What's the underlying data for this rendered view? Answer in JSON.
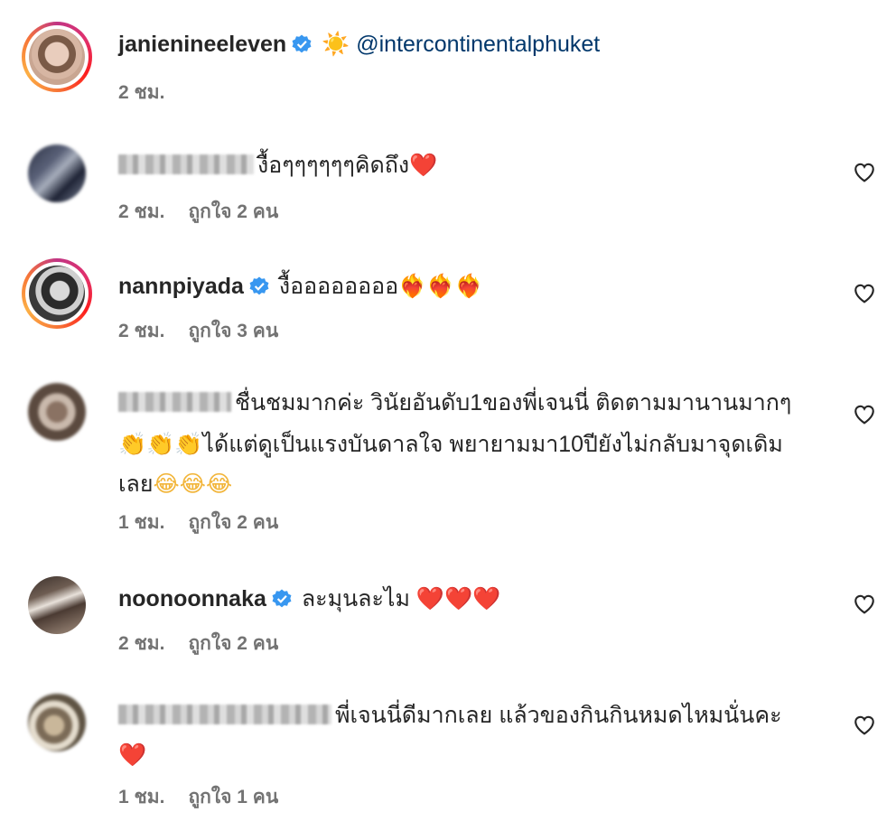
{
  "post": {
    "username": "janienineeleven",
    "sun_emoji": "☀️",
    "mention": "@intercontinentalphuket",
    "time": "2 ชม."
  },
  "comments": [
    {
      "username": "",
      "text": "งื้อๆๆๆๆๆๆคิดถึง",
      "emoji": "❤️",
      "time": "2 ชม.",
      "likes": "ถูกใจ 2 คน"
    },
    {
      "username": "nannpiyada",
      "text": "งื้ออออออออ",
      "emoji": "❤️‍🔥❤️‍🔥❤️‍🔥",
      "time": "2 ชม.",
      "likes": "ถูกใจ 3 คน"
    },
    {
      "username": "",
      "text_line1": "ชื่นชมมากค่ะ วินัยอันดับ1ของพี่เจนนี่ ติดตามมานานมากๆ",
      "emoji_clap": "👏👏👏",
      "text_line2": "ได้แต่ดูเป็นแรงบันดาลใจ พยายามมา10ปียังไม่กลับมาจุดเดิม",
      "text_line3": "เลย",
      "emoji_laugh": "😂😂😂",
      "time": "1 ชม.",
      "likes": "ถูกใจ 2 คน"
    },
    {
      "username": "noonoonnaka",
      "text": "ละมุนละไม",
      "emoji": "❤️❤️❤️",
      "time": "2 ชม.",
      "likes": "ถูกใจ 2 คน"
    },
    {
      "username": "",
      "text_line1": "พี่เจนนี่ดีมากเลย แล้วของกินกินหมดไหมนั่นคะ",
      "emoji": "❤️",
      "time": "1 ชม.",
      "likes": "ถูกใจ 1 คน"
    }
  ],
  "colors": {
    "verified": "#3897f0",
    "mention": "#00376b",
    "meta": "#737373"
  }
}
